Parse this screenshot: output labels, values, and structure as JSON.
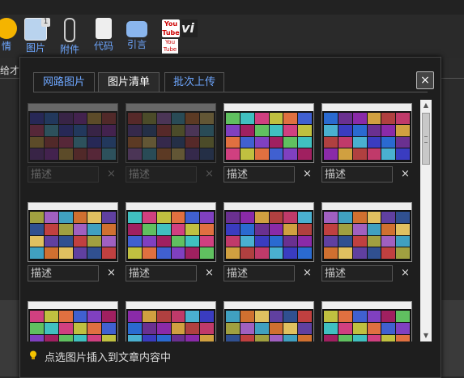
{
  "toolbar": {
    "items": [
      {
        "label": "情",
        "icon": "emoji-smile-icon"
      },
      {
        "label": "图片",
        "icon": "image-icon",
        "badge": "1"
      },
      {
        "label": "附件",
        "icon": "paperclip-icon"
      },
      {
        "label": "代码",
        "icon": "code-icon"
      },
      {
        "label": "引言",
        "icon": "quote-bubble-icon"
      }
    ],
    "video_icons": [
      "youtube-icon",
      "vimeo-icon",
      "youtube-small-icon"
    ],
    "youtube_text": "You Tube",
    "vimeo_text": "vi",
    "youtube_small_text": "You Tube"
  },
  "editor": {
    "left_fragment": "给才"
  },
  "popup": {
    "tabs": [
      "网路图片",
      "图片清单",
      "批次上传"
    ],
    "active_tab": 1,
    "close_label": "×",
    "items": [
      {
        "desc_placeholder": "描述",
        "remove": "×",
        "enabled": false
      },
      {
        "desc_placeholder": "描述",
        "remove": "×",
        "enabled": false
      },
      {
        "desc_placeholder": "描述",
        "remove": "×",
        "enabled": true
      },
      {
        "desc_placeholder": "描述",
        "remove": "×",
        "enabled": true
      },
      {
        "desc_placeholder": "描述",
        "remove": "×",
        "enabled": true
      },
      {
        "desc_placeholder": "描述",
        "remove": "×",
        "enabled": true
      },
      {
        "desc_placeholder": "描述",
        "remove": "×",
        "enabled": true
      },
      {
        "desc_placeholder": "描述",
        "remove": "×",
        "enabled": true
      },
      {
        "desc_placeholder": "",
        "remove": "",
        "enabled": true
      },
      {
        "desc_placeholder": "",
        "remove": "",
        "enabled": true
      },
      {
        "desc_placeholder": "",
        "remove": "",
        "enabled": true
      },
      {
        "desc_placeholder": "",
        "remove": "",
        "enabled": true
      }
    ],
    "footer_tip": "点选图片插入到文章内容中",
    "tip_icon": "lightbulb-icon"
  },
  "colors": {
    "link_blue": "#6ea7ff",
    "panel_bg": "#1e1e1e",
    "tip_yellow": "#f5c400"
  }
}
